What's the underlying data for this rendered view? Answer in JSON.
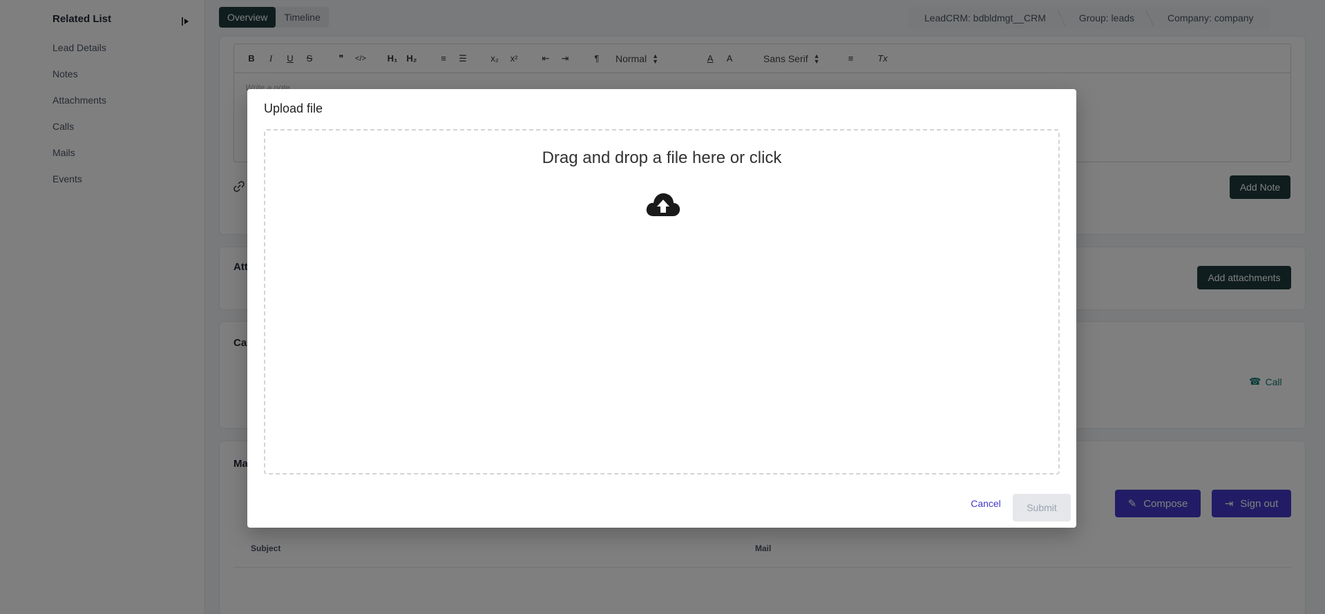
{
  "sidebar": {
    "title": "Related List",
    "items": [
      {
        "label": "Lead Details"
      },
      {
        "label": "Notes"
      },
      {
        "label": "Attachments"
      },
      {
        "label": "Calls"
      },
      {
        "label": "Mails"
      },
      {
        "label": "Events"
      }
    ]
  },
  "tabs": [
    {
      "label": "Overview",
      "active": true
    },
    {
      "label": "Timeline",
      "active": false
    }
  ],
  "breadcrumb": [
    {
      "label": "LeadCRM: bdbldmgt__CRM"
    },
    {
      "label": "Group: leads"
    },
    {
      "label": "Company: company"
    }
  ],
  "editor": {
    "toolbar": {
      "bold": "B",
      "italic": "I",
      "underline": "U",
      "strike": "S",
      "quote": "❞",
      "code": "</>",
      "h1": "H₁",
      "h2": "H₂",
      "ordered_list": "≡",
      "bullet_list": "☰",
      "subscript": "x₂",
      "superscript": "x²",
      "outdent": "⇤",
      "indent": "⇥",
      "direction": "¶",
      "size_select": "Normal",
      "text_color": "A",
      "background_color": "A",
      "font_select": "Sans Serif",
      "align": "≡",
      "clear_format": "Tx"
    },
    "placeholder": "Write a note..."
  },
  "notes": {
    "add_note_label": "Add Note"
  },
  "attachments": {
    "title": "Att",
    "add_label": "Add attachments"
  },
  "calls": {
    "title": "Ca",
    "call_label": "Call"
  },
  "mails": {
    "title": "Ma",
    "compose_label": "Compose",
    "signout_label": "Sign out",
    "columns": [
      "Subject",
      "Mail"
    ]
  },
  "modal": {
    "title": "Upload file",
    "dropzone_text": "Drag and drop a file here or click",
    "cancel_label": "Cancel",
    "submit_label": "Submit"
  },
  "colors": {
    "primary_dark": "#1f3a3d",
    "accent_purple": "#4338ca",
    "call_green": "#0f766e"
  }
}
